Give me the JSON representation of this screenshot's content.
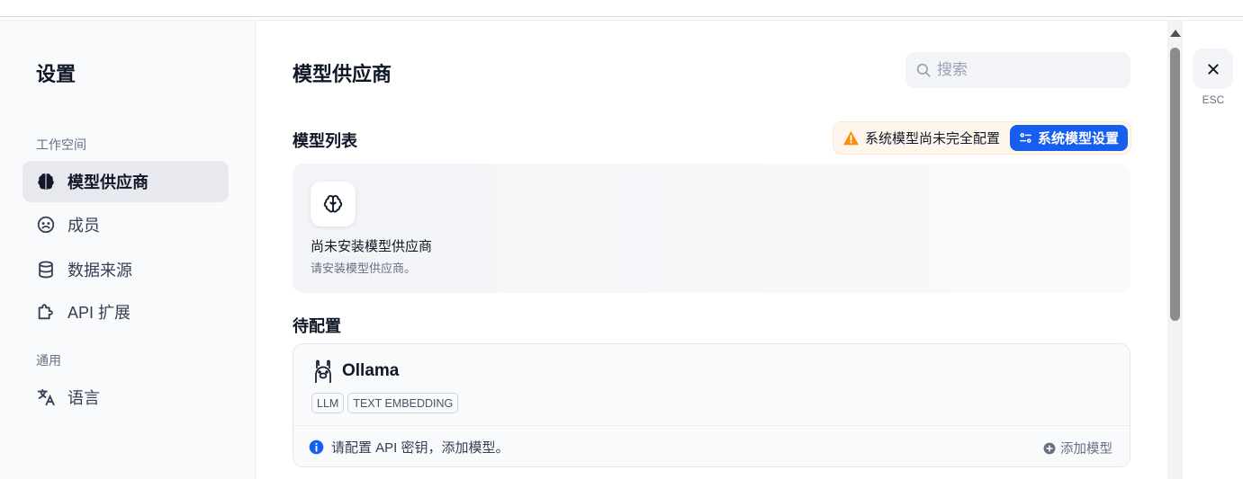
{
  "sidebar": {
    "title": "设置",
    "sections": [
      {
        "label": "工作空间",
        "items": [
          {
            "label": "模型供应商",
            "icon": "brain-icon",
            "active": true
          },
          {
            "label": "成员",
            "icon": "members-icon",
            "active": false
          },
          {
            "label": "数据来源",
            "icon": "database-icon",
            "active": false
          },
          {
            "label": "API 扩展",
            "icon": "puzzle-icon",
            "active": false
          }
        ]
      },
      {
        "label": "通用",
        "items": [
          {
            "label": "语言",
            "icon": "translate-icon",
            "active": false
          }
        ]
      }
    ]
  },
  "main": {
    "title": "模型供应商",
    "search": {
      "placeholder": "搜索",
      "value": ""
    },
    "model_list": {
      "title": "模型列表",
      "warning": "系统模型尚未完全配置",
      "system_settings_button": "系统模型设置",
      "empty": {
        "title": "尚未安装模型供应商",
        "subtitle": "请安装模型供应商。"
      }
    },
    "pending": {
      "title": "待配置",
      "providers": [
        {
          "name": "Ollama",
          "icon": "llama-icon",
          "tags": [
            "LLM",
            "TEXT EMBEDDING"
          ],
          "footer_text": "请配置 API 密钥，添加模型。",
          "add_model_label": "添加模型"
        }
      ]
    }
  },
  "close": {
    "esc_label": "ESC"
  },
  "colors": {
    "primary": "#155eef",
    "warning": "#f79009",
    "info": "#155eef",
    "active_nav_bg": "#e7e9ef"
  }
}
